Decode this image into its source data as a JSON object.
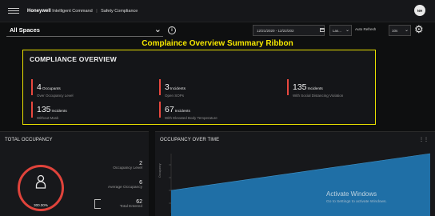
{
  "app": {
    "brand": "Honeywell",
    "product": "Intelligent Command",
    "module": "Safety Compliance",
    "avatar_initials": "NH"
  },
  "filters": {
    "space": "All Spaces",
    "date_range": "12/21/2020 - 12/22/202",
    "period": "Las...",
    "auto_refresh_label": "Auto Refresh",
    "interval": "10s"
  },
  "annotation": "Complaince Overview Summary Ribbon",
  "compliance": {
    "title": "COMPLIANCE OVERVIEW",
    "metrics": [
      {
        "value": "4",
        "unit": "Occupants",
        "sub": "Over Occupancy Level"
      },
      {
        "value": "3",
        "unit": "Incidents",
        "sub": "Open SOPs"
      },
      {
        "value": "135",
        "unit": "Incidents",
        "sub": "With Social Distancing Violation"
      },
      {
        "value": "135",
        "unit": "Incidents",
        "sub": "Without Mask"
      },
      {
        "value": "67",
        "unit": "Incidents",
        "sub": "With Elevated Body Temperature"
      }
    ],
    "accent": "#e8483f",
    "highlight": "#e8e000"
  },
  "total_occupancy": {
    "title": "TOTAL OCCUPANCY",
    "gauge_value": "300.00%",
    "stats": [
      {
        "value": "2",
        "label": "Occupancy Level"
      },
      {
        "value": "6",
        "label": "Average Occupancy"
      },
      {
        "value": "62",
        "label": "Total Entered"
      }
    ]
  },
  "occupancy_over_time": {
    "title": "OCCUPANCY OVER TIME",
    "y_label": "Occupancy",
    "fill_color": "#1f6fa6"
  },
  "watermark": {
    "line1": "Activate Windows",
    "line2": "Go to Settings to activate Windows."
  }
}
